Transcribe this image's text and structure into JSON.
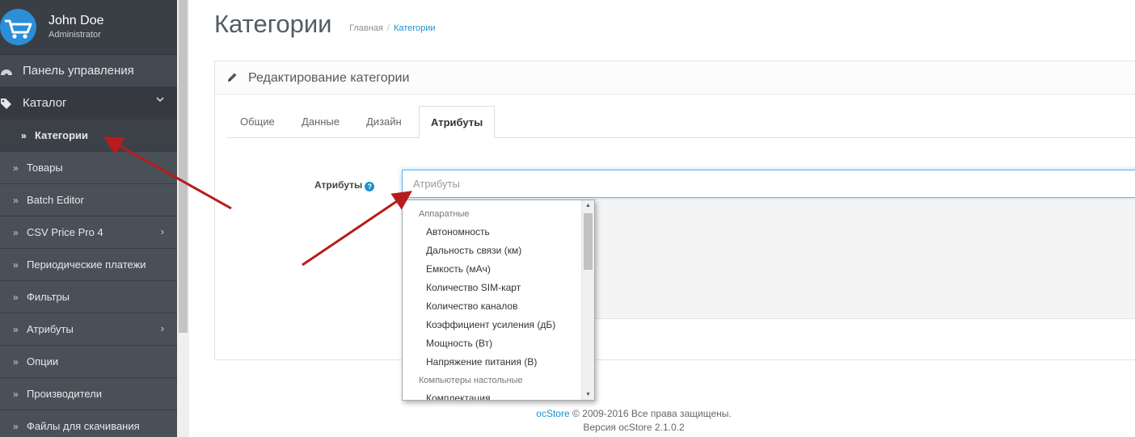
{
  "profile": {
    "name": "John Doe",
    "role": "Administrator"
  },
  "sidebar": {
    "items": [
      {
        "label": "Панель управления"
      },
      {
        "label": "Каталог"
      },
      {
        "label": "Категории"
      },
      {
        "label": "Товары"
      },
      {
        "label": "Batch Editor"
      },
      {
        "label": "CSV Price Pro 4"
      },
      {
        "label": "Периодические платежи"
      },
      {
        "label": "Фильтры"
      },
      {
        "label": "Атрибуты"
      },
      {
        "label": "Опции"
      },
      {
        "label": "Производители"
      },
      {
        "label": "Файлы для скачивания"
      }
    ]
  },
  "header": {
    "title": "Категории",
    "breadcrumb": [
      "Главная",
      "Категории"
    ]
  },
  "panel": {
    "title": "Редактирование категории",
    "tabs": [
      {
        "label": "Общие"
      },
      {
        "label": "Данные"
      },
      {
        "label": "Дизайн"
      },
      {
        "label": "Атрибуты"
      }
    ],
    "field_label": "Атрибуты",
    "help_icon": "?",
    "input_placeholder": "Атрибуты"
  },
  "dropdown": {
    "groups": [
      {
        "name": "Аппаратные",
        "items": [
          "Автономность",
          "Дальность связи (км)",
          "Емкость (мАч)",
          "Количество SIM-карт",
          "Количество каналов",
          "Коэффициент усиления (дБ)",
          "Мощность (Вт)",
          "Напряжение питания (В)"
        ]
      },
      {
        "name": "Компьютеры настольные",
        "items": [
          "Комплектация"
        ]
      }
    ]
  },
  "footer": {
    "brand": "ocStore",
    "copyright": "© 2009-2016 Все права защищены.",
    "version": "Версия ocStore 2.1.0.2"
  },
  "colors": {
    "accent": "#1e91cf",
    "sidebar": "#444a52",
    "arrow": "#b71c1c"
  },
  "icons": [
    "cart-logo-icon",
    "dashboard-icon",
    "tags-icon",
    "chevron-down-icon",
    "double-angle-right-icon",
    "chevron-right-icon",
    "pencil-icon",
    "help-icon",
    "scroll-up-icon",
    "scroll-down-icon"
  ]
}
